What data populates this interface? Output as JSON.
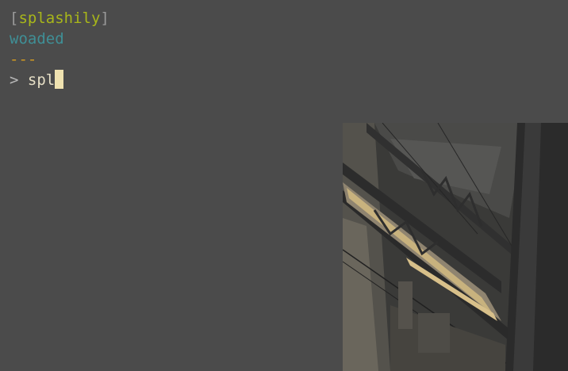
{
  "header": {
    "bracket_open": "[",
    "title": "splashily",
    "bracket_close": "]"
  },
  "subtitle": "woaded",
  "separator": "---",
  "prompt": {
    "symbol": ">",
    "input_value": "spl"
  },
  "image": {
    "icon": "station-roof-photo"
  }
}
